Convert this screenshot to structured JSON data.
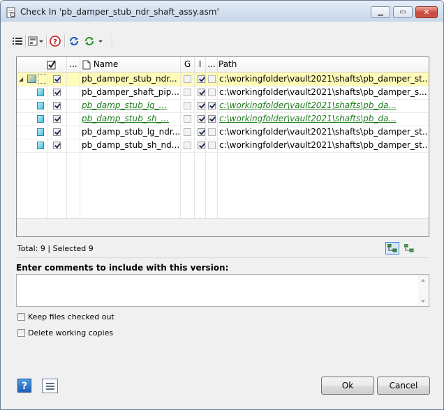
{
  "window": {
    "title": "Check In 'pb_damper_stub_ndr_shaft_assy.asm'"
  },
  "toolbar": {
    "items": [
      "list-view-icon",
      "layout-icon",
      "help-circle-icon",
      "refresh-icon",
      "refresh-green-icon"
    ]
  },
  "grid": {
    "headers": {
      "check": "",
      "dots1": "...",
      "name": "Name",
      "g": "G",
      "i": "I",
      "dots2": "...",
      "path": "Path"
    },
    "rows": [
      {
        "name": "pb_damper_stub_ndr...",
        "path": "c:\\workingfolder\\vault2021\\shafts\\pb_damper_st...",
        "checked": true,
        "g": false,
        "i": true,
        "x": false,
        "style": "normal",
        "selected": true,
        "assembly": true
      },
      {
        "name": "pb_damper_shaft_pip...",
        "path": "c:\\workingfolder\\vault2021\\shafts\\pb_damper_s...",
        "checked": true,
        "g": false,
        "i": true,
        "x": false,
        "style": "normal",
        "selected": false,
        "assembly": false
      },
      {
        "name": "pb_damp_stub_lg_...",
        "path": "c:\\workingfolder\\vault2021\\shafts\\pb_da...",
        "checked": true,
        "g": false,
        "i": true,
        "x": true,
        "style": "green",
        "selected": false,
        "assembly": false
      },
      {
        "name": "pb_damp_stub_sh_...",
        "path": "c:\\workingfolder\\vault2021\\shafts\\pb_da...",
        "checked": true,
        "g": false,
        "i": true,
        "x": true,
        "style": "green",
        "selected": false,
        "assembly": false
      },
      {
        "name": "pb_damp_stub_lg_ndr...",
        "path": "c:\\workingfolder\\vault2021\\shafts\\pb_damper_st...",
        "checked": true,
        "g": false,
        "i": true,
        "x": false,
        "style": "normal",
        "selected": false,
        "assembly": false
      },
      {
        "name": "pb_damp_stub_sh_nd...",
        "path": "c:\\workingfolder\\vault2021\\shafts\\pb_damper_st...",
        "checked": true,
        "g": false,
        "i": true,
        "x": false,
        "style": "normal",
        "selected": false,
        "assembly": false
      }
    ]
  },
  "status": {
    "text": "Total: 9 | Selected 9"
  },
  "comments": {
    "label": "Enter comments to include with this version:",
    "value": ""
  },
  "options": {
    "keep_checked_out": {
      "label": "Keep files checked out",
      "checked": false
    },
    "delete_working": {
      "label": "Delete working copies",
      "checked": false
    }
  },
  "buttons": {
    "ok": "Ok",
    "cancel": "Cancel",
    "help": "?"
  }
}
